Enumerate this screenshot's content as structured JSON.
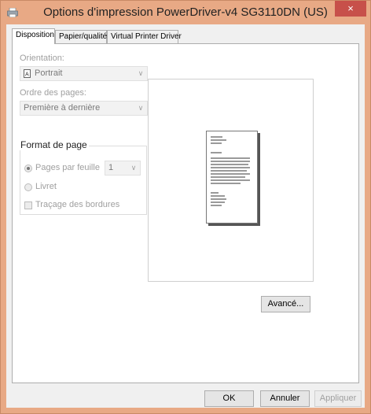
{
  "window": {
    "title": "Options d'impression PowerDriver-v4 SG3110DN (US)",
    "close_glyph": "×"
  },
  "tabs": [
    "Disposition",
    "Papier/qualité",
    "Virtual Printer Driver"
  ],
  "layout_tab": {
    "orientation_label": "Orientation:",
    "orientation_value": "Portrait",
    "page_order_label": "Ordre des pages:",
    "page_order_value": "Première à dernière",
    "page_format_title": "Format de page",
    "pages_per_sheet_label": "Pages par feuille",
    "pages_per_sheet_value": "1",
    "booklet_label": "Livret",
    "borders_label": "Traçage des bordures",
    "advanced_button": "Avancé..."
  },
  "footer": {
    "ok": "OK",
    "cancel": "Annuler",
    "apply": "Appliquer"
  },
  "colors": {
    "titlebar": "#e8a985",
    "close_button": "#c7504a",
    "dialog_bg": "#f0f0f0"
  },
  "icons": {
    "app": "printer-icon",
    "orientation": "portrait-page-icon"
  },
  "state": {
    "pages_per_sheet_selected": true,
    "booklet_selected": false,
    "draw_borders_checked": false
  }
}
